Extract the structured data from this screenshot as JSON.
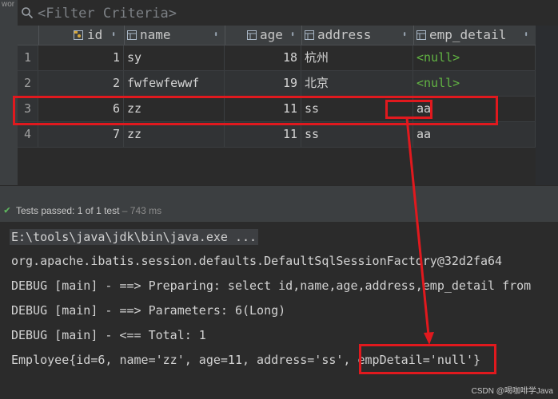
{
  "left_strip": {
    "cut_text": "wor"
  },
  "filter": {
    "placeholder": "<Filter Criteria>"
  },
  "columns": [
    {
      "name": "id",
      "icon": "key-column-icon"
    },
    {
      "name": "name",
      "icon": "column-icon"
    },
    {
      "name": "age",
      "icon": "column-icon"
    },
    {
      "name": "address",
      "icon": "column-icon"
    },
    {
      "name": "emp_detail",
      "icon": "column-icon"
    }
  ],
  "rows": [
    {
      "rownum": "1",
      "id": "1",
      "name": "sy",
      "age": "18",
      "address": "杭州",
      "emp_detail": "<null>"
    },
    {
      "rownum": "2",
      "id": "2",
      "name": "fwfewfewwf",
      "age": "19",
      "address": "北京",
      "emp_detail": "<null>"
    },
    {
      "rownum": "3",
      "id": "6",
      "name": "zz",
      "age": "11",
      "address": "ss",
      "emp_detail": "aa"
    },
    {
      "rownum": "4",
      "id": "7",
      "name": "zz",
      "age": "11",
      "address": "ss",
      "emp_detail": "aa"
    }
  ],
  "tests": {
    "status": "Tests passed:",
    "count": "1 of 1 test",
    "duration": "– 743 ms"
  },
  "console": [
    "E:\\tools\\java\\jdk\\bin\\java.exe ...",
    "org.apache.ibatis.session.defaults.DefaultSqlSessionFactory@32d2fa64",
    "DEBUG [main] - ==>  Preparing: select id,name,age,address,emp_detail from",
    "DEBUG [main] - ==> Parameters: 6(Long)",
    "DEBUG [main] - <==      Total: 1",
    "Employee{id=6, name='zz', age=11, address='ss', empDetail='null'}"
  ],
  "watermark": "CSDN @喝咖啡学Java",
  "colors": {
    "accent_red": "#e0191e",
    "null_green": "#62b543",
    "pass_green": "#5fb85f"
  }
}
